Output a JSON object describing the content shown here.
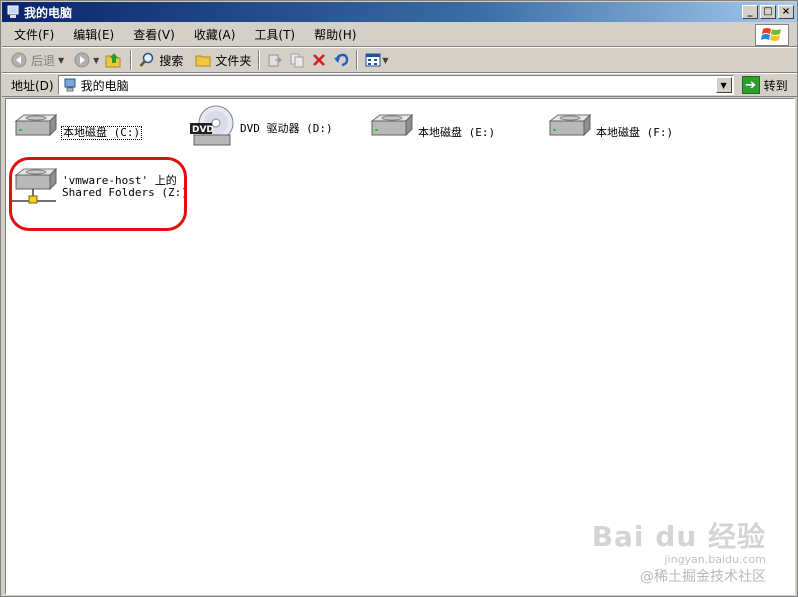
{
  "window": {
    "title": "我的电脑",
    "minimize": "_",
    "maximize": "□",
    "close": "×"
  },
  "menubar": {
    "items": [
      "文件(F)",
      "编辑(E)",
      "查看(V)",
      "收藏(A)",
      "工具(T)",
      "帮助(H)"
    ]
  },
  "toolbar": {
    "back_label": "后退",
    "search_label": "搜索",
    "folders_label": "文件夹"
  },
  "address": {
    "label": "地址(D)",
    "value": "我的电脑",
    "go_label": "转到"
  },
  "drives": [
    {
      "label": "本地磁盘 (C:)",
      "icon": "hard-drive-icon"
    },
    {
      "label": "DVD 驱动器 (D:)",
      "icon": "dvd-drive-icon"
    },
    {
      "label": "本地磁盘 (E:)",
      "icon": "hard-drive-icon"
    },
    {
      "label": "本地磁盘 (F:)",
      "icon": "hard-drive-icon"
    },
    {
      "label_line1": "'vmware-host' 上的",
      "label_line2": "Shared Folders (Z:)",
      "icon": "network-drive-icon"
    }
  ],
  "watermark": {
    "brand": "Bai du 经验",
    "url": "jingyan.baidu.com",
    "community": "@稀土掘金技术社区"
  },
  "colors": {
    "title_bar": "#0a246a",
    "highlight_ring": "#e01010",
    "window_face": "#d4d0c8"
  }
}
